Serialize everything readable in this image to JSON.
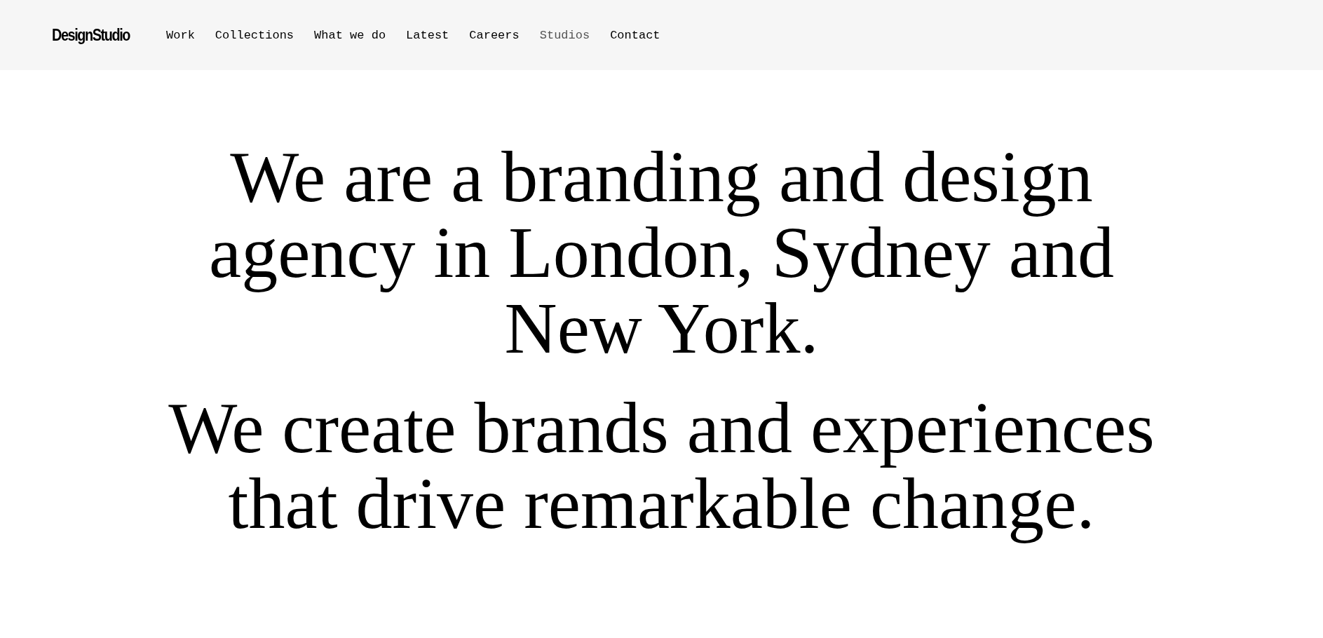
{
  "header": {
    "logo": "DesignStudio",
    "nav": [
      {
        "label": "Work",
        "selected": false
      },
      {
        "label": "Collections",
        "selected": false
      },
      {
        "label": "What we do",
        "selected": false
      },
      {
        "label": "Latest",
        "selected": false
      },
      {
        "label": "Careers",
        "selected": false
      },
      {
        "label": "Studios",
        "selected": true
      },
      {
        "label": "Contact",
        "selected": false
      }
    ]
  },
  "hero": {
    "paragraphs": [
      "We are a branding and design agency in London, Sydney and New York.",
      "We create brands and experiences that drive remarkable change."
    ]
  }
}
